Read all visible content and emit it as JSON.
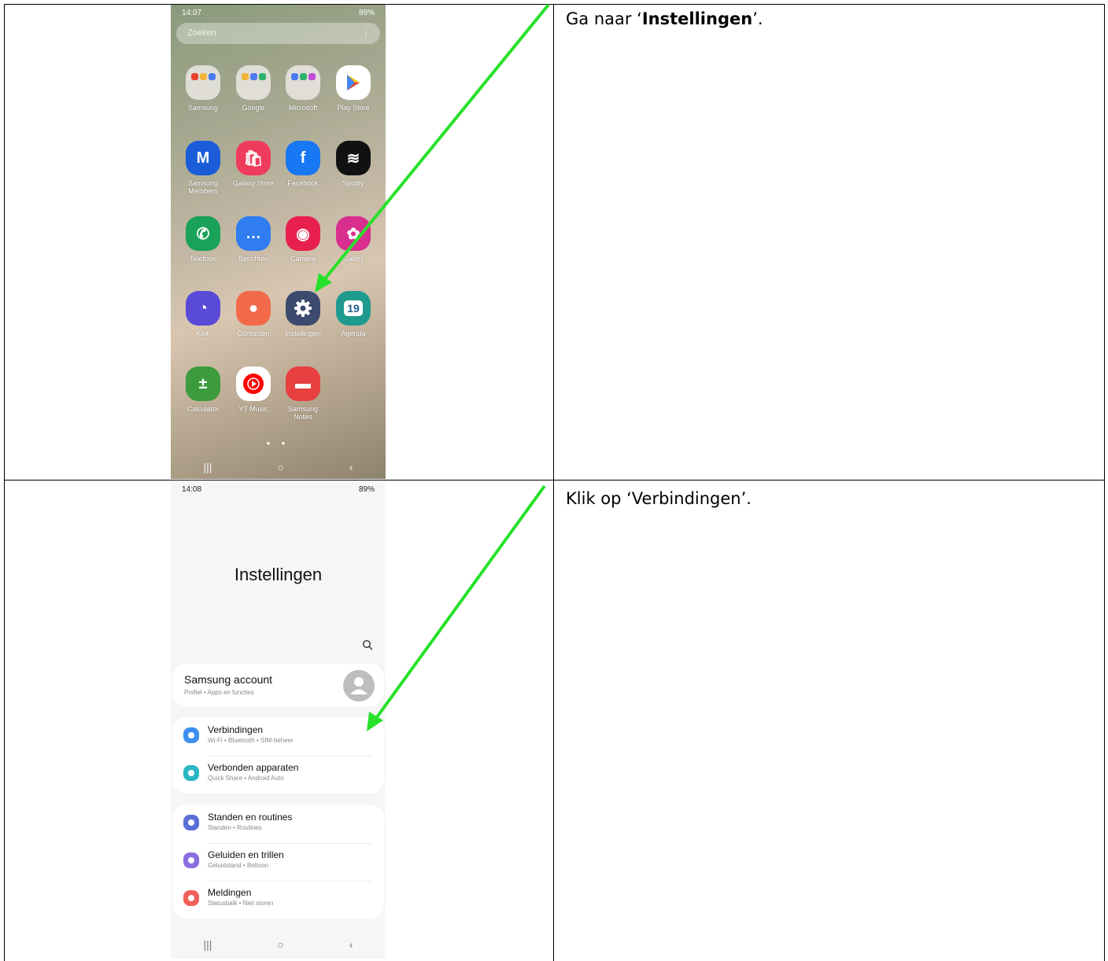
{
  "steps": [
    {
      "prefix": "Ga naar ‘",
      "bold": "Instellingen",
      "suffix": "’."
    },
    {
      "text": "Klik op ‘Verbindingen’."
    }
  ],
  "screen1": {
    "status": {
      "time": "14:07",
      "right": "89%"
    },
    "search_placeholder": "Zoeken",
    "apps": [
      {
        "label": "Samsung",
        "icon": "samsung-folder-icon"
      },
      {
        "label": "Google",
        "icon": "google-folder-icon"
      },
      {
        "label": "Microsoft",
        "icon": "microsoft-folder-icon"
      },
      {
        "label": "Play Store",
        "icon": "play-store-icon"
      },
      {
        "label": "Samsung\nMembers",
        "icon": "samsung-members-icon",
        "glyph": "M"
      },
      {
        "label": "Galaxy Store",
        "icon": "galaxy-store-icon",
        "glyph": "🛍"
      },
      {
        "label": "Facebook",
        "icon": "facebook-icon",
        "glyph": "f"
      },
      {
        "label": "Spotify",
        "icon": "spotify-icon",
        "glyph": "≋"
      },
      {
        "label": "Telefoon",
        "icon": "phone-icon",
        "glyph": "✆"
      },
      {
        "label": "Berichten",
        "icon": "messages-icon",
        "glyph": "…"
      },
      {
        "label": "Camera",
        "icon": "camera-icon",
        "glyph": "◉"
      },
      {
        "label": "Galerij",
        "icon": "gallery-icon",
        "glyph": "✿"
      },
      {
        "label": "Klok",
        "icon": "clock-icon",
        "glyph": "◔"
      },
      {
        "label": "Contacten",
        "icon": "contacts-icon",
        "glyph": "●"
      },
      {
        "label": "Instellingen",
        "icon": "settings-icon",
        "glyph": "⚙"
      },
      {
        "label": "Agenda",
        "icon": "calendar-icon",
        "glyph": "19"
      },
      {
        "label": "Calculator",
        "icon": "calculator-icon",
        "glyph": "±"
      },
      {
        "label": "YT Music",
        "icon": "yt-music-icon",
        "glyph": "▶"
      },
      {
        "label": "Samsung\nNotes",
        "icon": "samsung-notes-icon",
        "glyph": "▬"
      }
    ]
  },
  "screen2": {
    "status": {
      "time": "14:08",
      "right": "89%"
    },
    "title": "Instellingen",
    "account": {
      "title": "Samsung account",
      "subtitle": "Profiel • Apps en functies"
    },
    "group1": [
      {
        "title": "Verbindingen",
        "subtitle": "Wi-Fi • Bluetooth • SIM-beheer",
        "icon": "wifi-icon",
        "color": "#3d8ff0"
      },
      {
        "title": "Verbonden apparaten",
        "subtitle": "Quick Share • Android Auto",
        "icon": "devices-icon",
        "color": "#2bb8c4"
      }
    ],
    "group2": [
      {
        "title": "Standen en routines",
        "subtitle": "Standen • Routines",
        "icon": "routines-icon",
        "color": "#5a6fd6"
      },
      {
        "title": "Geluiden en trillen",
        "subtitle": "Geluidstand • Beltoon",
        "icon": "sound-icon",
        "color": "#8a6ee0"
      },
      {
        "title": "Meldingen",
        "subtitle": "Statusbalk • Niet storen",
        "icon": "notifications-icon",
        "color": "#f0615a"
      }
    ]
  },
  "colors": {
    "arrow": "#28e12a"
  }
}
